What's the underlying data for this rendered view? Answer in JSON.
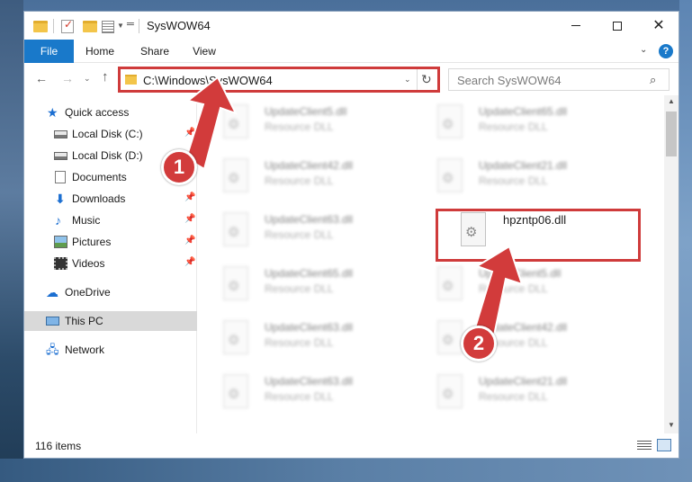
{
  "window": {
    "title": "SysWOW64"
  },
  "ribbon": {
    "tabs": [
      "File",
      "Home",
      "Share",
      "View"
    ],
    "help": "?"
  },
  "address": {
    "path": "C:\\Windows\\SysWOW64",
    "search_placeholder": "Search SysWOW64"
  },
  "sidebar": {
    "items": [
      {
        "label": "Quick access",
        "icon": "star-icon",
        "pinned": false
      },
      {
        "label": "Local Disk (C:)",
        "icon": "drive-icon",
        "pinned": true
      },
      {
        "label": "Local Disk (D:)",
        "icon": "drive-icon",
        "pinned": true
      },
      {
        "label": "Documents",
        "icon": "documents-icon",
        "pinned": true
      },
      {
        "label": "Downloads",
        "icon": "download-icon",
        "pinned": true
      },
      {
        "label": "Music",
        "icon": "music-icon",
        "pinned": true
      },
      {
        "label": "Pictures",
        "icon": "pictures-icon",
        "pinned": true
      },
      {
        "label": "Videos",
        "icon": "videos-icon",
        "pinned": true
      },
      {
        "label": "OneDrive",
        "icon": "cloud-icon",
        "pinned": false
      },
      {
        "label": "This PC",
        "icon": "computer-icon",
        "pinned": false,
        "selected": true
      },
      {
        "label": "Network",
        "icon": "network-icon",
        "pinned": false
      }
    ]
  },
  "files": {
    "left": [
      {
        "name": "UpdateClient5.dll",
        "type": "Resource DLL"
      },
      {
        "name": "UpdateClient42.dll",
        "type": "Resource DLL"
      },
      {
        "name": "UpdateClient63.dll",
        "type": "Resource DLL"
      },
      {
        "name": "UpdateClient65.dll",
        "type": "Resource DLL"
      },
      {
        "name": "UpdateClient63.dll",
        "type": "Resource DLL"
      },
      {
        "name": "UpdateClient63.dll",
        "type": "Resource DLL"
      }
    ],
    "right": [
      {
        "name": "UpdateClient65.dll",
        "type": "Resource DLL"
      },
      {
        "name": "UpdateClient21.dll",
        "type": "Resource DLL"
      },
      {
        "name": "hpzntp06.dll",
        "type": ""
      },
      {
        "name": "UpdateClient5.dll",
        "type": "Resource DLL"
      },
      {
        "name": "UpdateClient42.dll",
        "type": "Resource DLL"
      },
      {
        "name": "UpdateClient21.dll",
        "type": "Resource DLL"
      }
    ]
  },
  "status": {
    "item_count": "116 items"
  },
  "annotations": {
    "step1": "1",
    "step2": "2",
    "color": "#d23b3b"
  },
  "colors": {
    "accent": "#1979ca",
    "highlight": "#cf3b3b"
  }
}
